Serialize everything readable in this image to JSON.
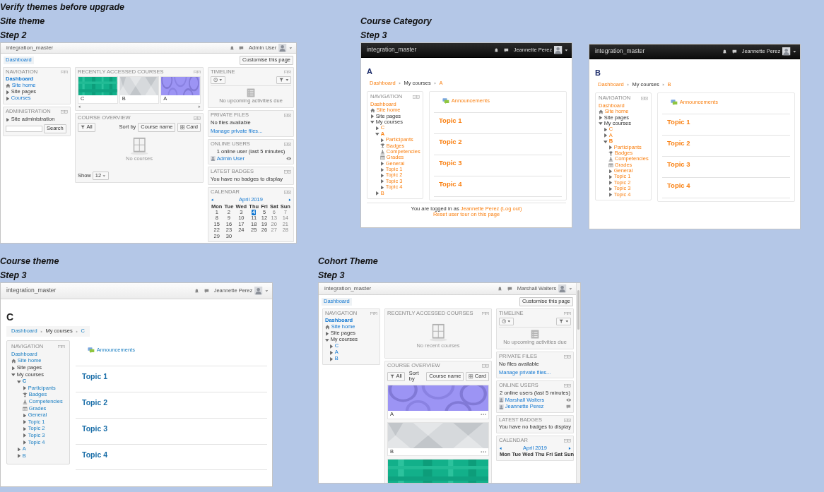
{
  "title": "Verify themes before upgrade",
  "sections": [
    {
      "kind": "dashboard",
      "heading": "Site theme",
      "step": "Step 2",
      "screen": {
        "site_name": "integration_master",
        "user_name": "Admin User",
        "breadcrumb": "Dashboard",
        "customise": "Customise this page",
        "columns": [
          [
            {
              "kind": "navigation",
              "title": "NAVIGATION",
              "items": [
                {
                  "label": "Dashboard",
                  "kind": "leaf",
                  "link": true,
                  "current": true
                },
                {
                  "label": "Site home",
                  "kind": "home",
                  "link": true,
                  "current": false
                },
                {
                  "label": "Site pages",
                  "kind": "branch",
                  "link": false,
                  "current": false,
                  "expanded": false
                },
                {
                  "label": "Courses",
                  "kind": "branch",
                  "link": true,
                  "current": false,
                  "expanded": false
                }
              ]
            },
            {
              "kind": "navigation",
              "title": "ADMINISTRATION",
              "items": [
                {
                  "label": "Site administration",
                  "kind": "branch",
                  "link": false,
                  "current": false,
                  "expanded": false
                }
              ],
              "search_button": "Search"
            }
          ],
          [
            {
              "kind": "recent",
              "title": "RECENTLY ACCESSED COURSES",
              "courses": [
                {
                  "name": "C",
                  "kind": "grid"
                },
                {
                  "name": "B",
                  "kind": "hexagons"
                },
                {
                  "name": "A",
                  "kind": "circles"
                }
              ]
            },
            {
              "kind": "overview",
              "title": "COURSE OVERVIEW",
              "filter": "All",
              "sort_label": "Sort by",
              "sort": "Course name",
              "view": "Card",
              "empty_text": "No courses",
              "show_label": "Show",
              "show": "12"
            }
          ],
          [
            {
              "kind": "timeline",
              "title": "TIMELINE",
              "empty_text": "No upcoming activities due"
            },
            {
              "kind": "files",
              "title": "PRIVATE FILES",
              "text": "No files available",
              "link": "Manage private files..."
            },
            {
              "kind": "online",
              "title": "ONLINE USERS",
              "text": "1 online user (last 5 minutes)",
              "users": [
                {
                  "name": "Admin User",
                  "kind": "viewer"
                }
              ]
            },
            {
              "kind": "badges",
              "title": "LATEST BADGES",
              "text": "You have no badges to display"
            },
            {
              "kind": "calendar",
              "title": "CALENDAR",
              "month": "April 2019",
              "days": [
                "Mon",
                "Tue",
                "Wed",
                "Thu",
                "Fri",
                "Sat",
                "Sun"
              ],
              "weeks": [
                [
                  {
                    "day": "1",
                    "today": false
                  },
                  {
                    "day": "2",
                    "today": false
                  },
                  {
                    "day": "3",
                    "today": false
                  },
                  {
                    "day": "4",
                    "today": true
                  },
                  {
                    "day": "5",
                    "today": false
                  },
                  {
                    "day": "6",
                    "today": false
                  },
                  {
                    "day": "7",
                    "today": false
                  }
                ],
                [
                  {
                    "day": "8",
                    "today": false
                  },
                  {
                    "day": "9",
                    "today": false
                  },
                  {
                    "day": "10",
                    "today": false
                  },
                  {
                    "day": "11",
                    "today": false
                  },
                  {
                    "day": "12",
                    "today": false
                  },
                  {
                    "day": "13",
                    "today": false
                  },
                  {
                    "day": "14",
                    "today": false
                  }
                ],
                [
                  {
                    "day": "15",
                    "today": false
                  },
                  {
                    "day": "16",
                    "today": false
                  },
                  {
                    "day": "17",
                    "today": false
                  },
                  {
                    "day": "18",
                    "today": false
                  },
                  {
                    "day": "19",
                    "today": false
                  },
                  {
                    "day": "20",
                    "today": false
                  },
                  {
                    "day": "21",
                    "today": false
                  }
                ],
                [
                  {
                    "day": "22",
                    "today": false
                  },
                  {
                    "day": "23",
                    "today": false
                  },
                  {
                    "day": "24",
                    "today": false
                  },
                  {
                    "day": "25",
                    "today": false
                  },
                  {
                    "day": "26",
                    "today": false
                  },
                  {
                    "day": "27",
                    "today": false
                  },
                  {
                    "day": "28",
                    "today": false
                  }
                ],
                [
                  {
                    "day": "29",
                    "today": false
                  },
                  {
                    "day": "30",
                    "today": false
                  }
                ]
              ]
            }
          ]
        ]
      }
    },
    {
      "kind": "course",
      "heading": "Course Category",
      "step": "Step 3",
      "screen": {
        "kind": "dark",
        "site_name": "integration_master",
        "user_name": "Jeannette Perez",
        "title": "A",
        "breadcrumb": [
          {
            "label": "Dashboard",
            "link": true
          },
          {
            "label": "My courses",
            "link": false
          },
          {
            "label": "A",
            "link": true
          }
        ],
        "nav_title": "NAVIGATION",
        "nav": [
          {
            "label": "Dashboard",
            "kind": "leaf",
            "link": true,
            "current": false
          },
          {
            "label": "Site home",
            "kind": "home",
            "link": true,
            "current": false
          },
          {
            "label": "Site pages",
            "kind": "branch",
            "link": false,
            "current": false,
            "expanded": false
          },
          {
            "label": "My courses",
            "kind": "branch",
            "link": false,
            "current": false,
            "expanded": true,
            "children": [
              {
                "label": "C",
                "kind": "branch",
                "link": true,
                "current": false,
                "expanded": false
              },
              {
                "label": "A",
                "kind": "branch",
                "link": true,
                "current": true,
                "expanded": true,
                "children": [
                  {
                    "label": "Participants",
                    "kind": "branch",
                    "link": true,
                    "current": false,
                    "expanded": false
                  },
                  {
                    "label": "Badges",
                    "kind": "badges",
                    "link": true,
                    "current": false
                  },
                  {
                    "label": "Competencies",
                    "kind": "competencies",
                    "link": true,
                    "current": false
                  },
                  {
                    "label": "Grades",
                    "kind": "grades",
                    "link": true,
                    "current": false
                  },
                  {
                    "label": "General",
                    "kind": "branch",
                    "link": true,
                    "current": false,
                    "expanded": false
                  },
                  {
                    "label": "Topic 1",
                    "kind": "branch",
                    "link": true,
                    "current": false,
                    "expanded": false
                  },
                  {
                    "label": "Topic 2",
                    "kind": "branch",
                    "link": true,
                    "current": false,
                    "expanded": false
                  },
                  {
                    "label": "Topic 3",
                    "kind": "branch",
                    "link": true,
                    "current": false,
                    "expanded": false
                  },
                  {
                    "label": "Topic 4",
                    "kind": "branch",
                    "link": true,
                    "current": false,
                    "expanded": false
                  }
                ]
              },
              {
                "label": "B",
                "kind": "branch",
                "link": true,
                "current": false,
                "expanded": false
              }
            ]
          }
        ],
        "activity": "Announcements",
        "topics": [
          "Topic 1",
          "Topic 2",
          "Topic 3",
          "Topic 4"
        ],
        "footer": {
          "text": "You are logged in as",
          "user": "Jeannette Perez",
          "logout": "(Log out)",
          "reset": "Reset user tour on this page"
        }
      }
    },
    {
      "kind": "course",
      "screen": {
        "kind": "dark",
        "site_name": "integration_master",
        "user_name": "Jeannette Perez",
        "title": "B",
        "breadcrumb": [
          {
            "label": "Dashboard",
            "link": true
          },
          {
            "label": "My courses",
            "link": false
          },
          {
            "label": "B",
            "link": true
          }
        ],
        "nav_title": "NAVIGATION",
        "nav": [
          {
            "label": "Dashboard",
            "kind": "leaf",
            "link": true,
            "current": false
          },
          {
            "label": "Site home",
            "kind": "home",
            "link": true,
            "current": false
          },
          {
            "label": "Site pages",
            "kind": "branch",
            "link": false,
            "current": false,
            "expanded": false
          },
          {
            "label": "My courses",
            "kind": "branch",
            "link": false,
            "current": false,
            "expanded": true,
            "children": [
              {
                "label": "C",
                "kind": "branch",
                "link": true,
                "current": false,
                "expanded": false
              },
              {
                "label": "A",
                "kind": "branch",
                "link": true,
                "current": false,
                "expanded": false
              },
              {
                "label": "B",
                "kind": "branch",
                "link": true,
                "current": true,
                "expanded": true,
                "children": [
                  {
                    "label": "Participants",
                    "kind": "branch",
                    "link": true,
                    "current": false,
                    "expanded": false
                  },
                  {
                    "label": "Badges",
                    "kind": "badges",
                    "link": true,
                    "current": false
                  },
                  {
                    "label": "Competencies",
                    "kind": "competencies",
                    "link": true,
                    "current": false
                  },
                  {
                    "label": "Grades",
                    "kind": "grades",
                    "link": true,
                    "current": false
                  },
                  {
                    "label": "General",
                    "kind": "branch",
                    "link": true,
                    "current": false,
                    "expanded": false
                  },
                  {
                    "label": "Topic 1",
                    "kind": "branch",
                    "link": true,
                    "current": false,
                    "expanded": false
                  },
                  {
                    "label": "Topic 2",
                    "kind": "branch",
                    "link": true,
                    "current": false,
                    "expanded": false
                  },
                  {
                    "label": "Topic 3",
                    "kind": "branch",
                    "link": true,
                    "current": false,
                    "expanded": false
                  },
                  {
                    "label": "Topic 4",
                    "kind": "branch",
                    "link": true,
                    "current": false,
                    "expanded": false
                  }
                ]
              }
            ]
          }
        ],
        "activity": "Announcements",
        "topics": [
          "Topic 1",
          "Topic 2",
          "Topic 3",
          "Topic 4"
        ]
      }
    },
    {
      "kind": "course",
      "heading": "Course theme",
      "step": "Step 3",
      "screen": {
        "kind": "light",
        "site_name": "integration_master",
        "user_name": "Jeannette Perez",
        "title": "C",
        "breadcrumb": [
          {
            "label": "Dashboard",
            "link": true
          },
          {
            "label": "My courses",
            "link": false
          },
          {
            "label": "C",
            "link": true
          }
        ],
        "nav_title": "NAVIGATION",
        "nav": [
          {
            "label": "Dashboard",
            "kind": "leaf",
            "link": true,
            "current": false
          },
          {
            "label": "Site home",
            "kind": "home",
            "link": true,
            "current": false
          },
          {
            "label": "Site pages",
            "kind": "branch",
            "link": false,
            "current": false,
            "expanded": false
          },
          {
            "label": "My courses",
            "kind": "branch",
            "link": false,
            "current": false,
            "expanded": true,
            "children": [
              {
                "label": "C",
                "kind": "branch",
                "link": true,
                "current": true,
                "expanded": true,
                "children": [
                  {
                    "label": "Participants",
                    "kind": "branch",
                    "link": true,
                    "current": false,
                    "expanded": false
                  },
                  {
                    "label": "Badges",
                    "kind": "badges",
                    "link": true,
                    "current": false
                  },
                  {
                    "label": "Competencies",
                    "kind": "competencies",
                    "link": true,
                    "current": false
                  },
                  {
                    "label": "Grades",
                    "kind": "grades",
                    "link": true,
                    "current": false
                  },
                  {
                    "label": "General",
                    "kind": "branch",
                    "link": true,
                    "current": false,
                    "expanded": false
                  },
                  {
                    "label": "Topic 1",
                    "kind": "branch",
                    "link": true,
                    "current": false,
                    "expanded": false
                  },
                  {
                    "label": "Topic 2",
                    "kind": "branch",
                    "link": true,
                    "current": false,
                    "expanded": false
                  },
                  {
                    "label": "Topic 3",
                    "kind": "branch",
                    "link": true,
                    "current": false,
                    "expanded": false
                  },
                  {
                    "label": "Topic 4",
                    "kind": "branch",
                    "link": true,
                    "current": false,
                    "expanded": false
                  }
                ]
              },
              {
                "label": "A",
                "kind": "branch",
                "link": true,
                "current": false,
                "expanded": false
              },
              {
                "label": "B",
                "kind": "branch",
                "link": true,
                "current": false,
                "expanded": false
              }
            ]
          }
        ],
        "activity": "Announcements",
        "topics": [
          "Topic 1",
          "Topic 2",
          "Topic 3",
          "Topic 4"
        ]
      }
    },
    {
      "kind": "dashboard",
      "heading": "Cohort Theme",
      "step": "Step 3",
      "screen": {
        "site_name": "integration_master",
        "user_name": "Marshall Walters",
        "breadcrumb": "Dashboard",
        "customise": "Customise this page",
        "columns": [
          [
            {
              "kind": "navigation",
              "title": "NAVIGATION",
              "items": [
                {
                  "label": "Dashboard",
                  "kind": "leaf",
                  "link": true,
                  "current": true
                },
                {
                  "label": "Site home",
                  "kind": "home",
                  "link": true,
                  "current": false
                },
                {
                  "label": "Site pages",
                  "kind": "branch",
                  "link": false,
                  "current": false,
                  "expanded": false
                },
                {
                  "label": "My courses",
                  "kind": "branch",
                  "link": false,
                  "current": false,
                  "expanded": true,
                  "children": [
                    {
                      "label": "C",
                      "kind": "branch",
                      "link": true,
                      "current": false,
                      "expanded": false
                    },
                    {
                      "label": "A",
                      "kind": "branch",
                      "link": true,
                      "current": false,
                      "expanded": false
                    },
                    {
                      "label": "B",
                      "kind": "branch",
                      "link": true,
                      "current": false,
                      "expanded": false
                    }
                  ]
                }
              ]
            }
          ],
          [
            {
              "kind": "recent",
              "title": "RECENTLY ACCESSED COURSES",
              "empty_text": "No recent courses"
            },
            {
              "kind": "overview",
              "title": "COURSE OVERVIEW",
              "filter": "All",
              "sort_label": "Sort by",
              "sort": "Course name",
              "view": "Card",
              "courses": [
                {
                  "name": "A",
                  "kind": "circles"
                },
                {
                  "name": "B",
                  "kind": "hexagons"
                },
                {
                  "kind": "grid"
                }
              ]
            }
          ],
          [
            {
              "kind": "timeline",
              "title": "TIMELINE",
              "empty_text": "No upcoming activities due"
            },
            {
              "kind": "files",
              "title": "PRIVATE FILES",
              "text": "No files available",
              "link": "Manage private files..."
            },
            {
              "kind": "online",
              "title": "ONLINE USERS",
              "text": "2 online users (last 5 minutes)",
              "users": [
                {
                  "name": "Marshall Walters",
                  "kind": "viewer"
                },
                {
                  "name": "Jeannette Perez",
                  "kind": "other"
                }
              ]
            },
            {
              "kind": "badges",
              "title": "LATEST BADGES",
              "text": "You have no badges to display"
            },
            {
              "kind": "calendar",
              "title": "CALENDAR",
              "month": "April 2019",
              "days": [
                "Mon",
                "Tue",
                "Wed",
                "Thu",
                "Fri",
                "Sat",
                "Sun"
              ]
            }
          ]
        ]
      }
    }
  ]
}
